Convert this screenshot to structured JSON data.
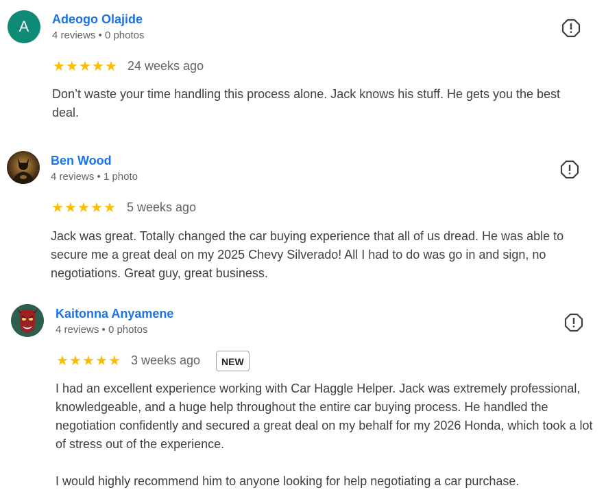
{
  "reviews": [
    {
      "name": "Adeogo Olajide",
      "avatar_letter": "A",
      "meta": "4 reviews • 0 photos",
      "rating": 5,
      "date": "24 weeks ago",
      "text": [
        "Don’t waste your time handling this process alone. Jack knows his stuff. He gets you the best deal."
      ]
    },
    {
      "name": "Ben Wood",
      "meta": "4 reviews • 1 photo",
      "rating": 5,
      "date": "5 weeks ago",
      "text": [
        "Jack was great. Totally changed the car buying experience that all of us dread. He was able to secure me a great deal on my 2025 Chevy Silverado! All I had to do was go in and sign, no negotiations. Great guy, great business."
      ]
    },
    {
      "name": "Kaitonna Anyamene",
      "meta": "4 reviews • 0 photos",
      "rating": 5,
      "date": "3 weeks ago",
      "badge": "NEW",
      "text": [
        "I had an excellent experience working with Car Haggle Helper. Jack was extremely professional, knowledgeable, and a huge help throughout the entire car buying process. He handled the negotiation confidently and secured a great deal on my behalf for my 2026 Honda, which took a lot of stress out of the experience.",
        "I would highly recommend him to anyone looking for help negotiating a car purchase."
      ]
    }
  ],
  "colors": {
    "name_link": "#1a73e8",
    "star": "#fbbc04",
    "avatar_bg": "#0f8a77"
  },
  "icons": {
    "report": "flag-icon",
    "star": "star-icon"
  }
}
